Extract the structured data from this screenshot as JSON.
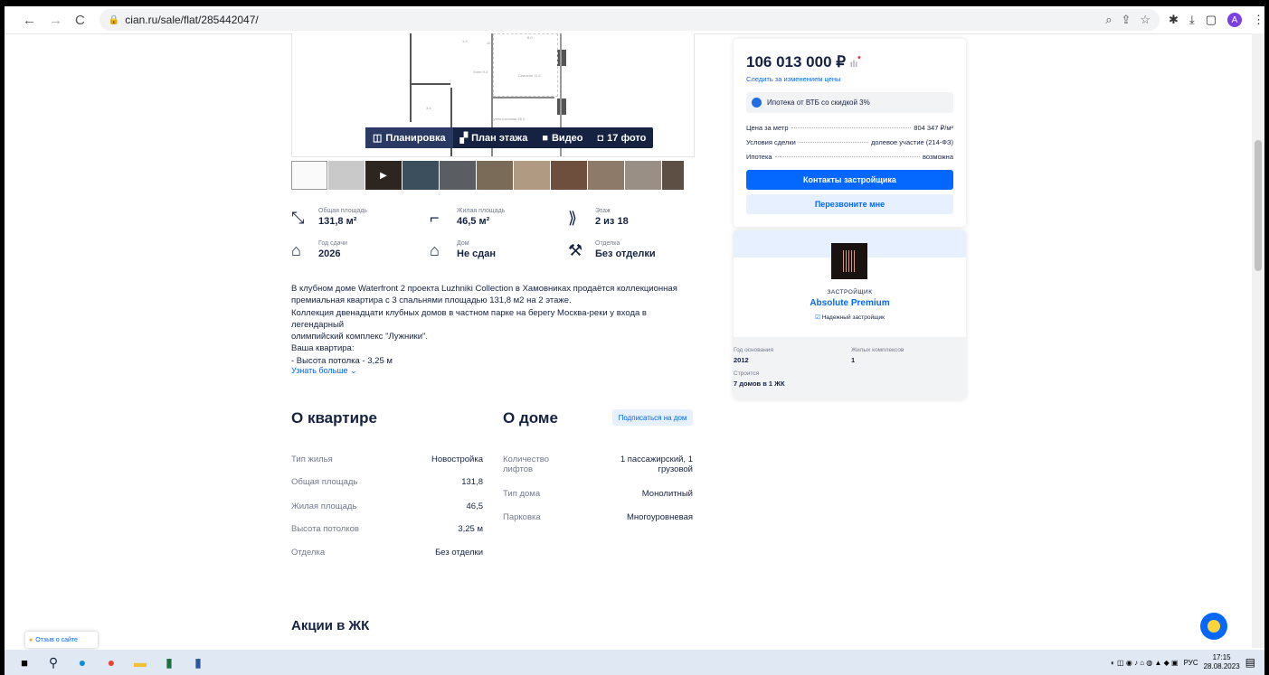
{
  "browser": {
    "url": "cian.ru/sale/flat/285442047/",
    "profile_initial": "A"
  },
  "gallery": {
    "tabs": [
      {
        "label": "Планировка",
        "icon": "floorplan-icon"
      },
      {
        "label": "План этажа",
        "icon": "floor-icon"
      },
      {
        "label": "Видео",
        "icon": "video-icon"
      },
      {
        "label": "17 фото",
        "icon": "camera-icon"
      }
    ],
    "plan_labels": [
      "Спальня 11,6",
      "Холл 9,3",
      "Кухня-гостиная 26,0",
      "3,4",
      "1,9",
      "10,1",
      "6,0"
    ]
  },
  "facts": [
    {
      "label": "Общая площадь",
      "value": "131,8 м²",
      "icon": "area-icon"
    },
    {
      "label": "Жилая площадь",
      "value": "46,5 м²",
      "icon": "living-area-icon"
    },
    {
      "label": "Этаж",
      "value": "2 из 18",
      "icon": "stairs-icon"
    },
    {
      "label": "Год сдачи",
      "value": "2026",
      "icon": "house-key-icon"
    },
    {
      "label": "Дом",
      "value": "Не сдан",
      "icon": "house-icon"
    },
    {
      "label": "Отделка",
      "value": "Без отделки",
      "icon": "finish-icon"
    }
  ],
  "description": {
    "lines": [
      "В клубном доме Waterfront 2 проекта Luzhniki Collection в Хамовниках продаётся коллекционная",
      "премиальная квартира с 3 спальнями площадью 131,8 м2 на 2 этаже.",
      "Коллекция двенадцати клубных домов в частном парке на берегу Москва-реки у входа в легендарный",
      "олимпийский комплекс \"Лужники\".",
      "Ваша квартира:",
      "-    Высота потолка - 3,25 м"
    ],
    "more_label": "Узнать больше"
  },
  "apartment": {
    "title": "О квартире",
    "rows": [
      {
        "k": "Тип жилья",
        "v": "Новостройка"
      },
      {
        "k": "Общая площадь",
        "v": "131,8"
      },
      {
        "k": "Жилая площадь",
        "v": "46,5"
      },
      {
        "k": "Высота потолков",
        "v": "3,25 м"
      },
      {
        "k": "Отделка",
        "v": "Без отделки"
      }
    ]
  },
  "house": {
    "title": "О доме",
    "subscribe_label": "Подписаться на дом",
    "rows": [
      {
        "k1": "Количество",
        "k2": "лифтов",
        "v1": "1 пассажирский, 1",
        "v2": "грузовой"
      },
      {
        "k1": "Тип дома",
        "k2": "",
        "v1": "Монолитный",
        "v2": ""
      },
      {
        "k1": "Парковка",
        "k2": "",
        "v1": "Многоуровневая",
        "v2": ""
      }
    ]
  },
  "price_card": {
    "price": "106 013 000 ₽",
    "follow_label": "Следить за изменением цены",
    "mortgage_label": "Ипотека от ВТБ со скидкой 3%",
    "params": [
      {
        "k": "Цена за метр",
        "v": "804 347 ₽/м²"
      },
      {
        "k": "Условия сделки",
        "v": "долевое участие (214-ФЗ)"
      },
      {
        "k": "Ипотека",
        "v": "возможна"
      }
    ],
    "contact_button": "Контакты застройщика",
    "callback_button": "Перезвоните мне"
  },
  "developer": {
    "role": "ЗАСТРОЙЩИК",
    "name": "Absolute Premium",
    "reliable": "Надежный застройщик",
    "stats": [
      {
        "k": "Год основания",
        "v": "2012"
      },
      {
        "k": "Жилых комплексов",
        "v": "1"
      },
      {
        "k": "Строится",
        "v": "7 домов в 1 ЖК"
      }
    ]
  },
  "promo": {
    "title": "Акции в ЖК"
  },
  "feedback": {
    "label": "Отзыв о сайте"
  },
  "taskbar": {
    "lang": "РУС",
    "time": "17:15",
    "date": "28.08.2023"
  },
  "colors": {
    "accent": "#0468ff",
    "text": "#152242",
    "muted": "#737a8e"
  }
}
